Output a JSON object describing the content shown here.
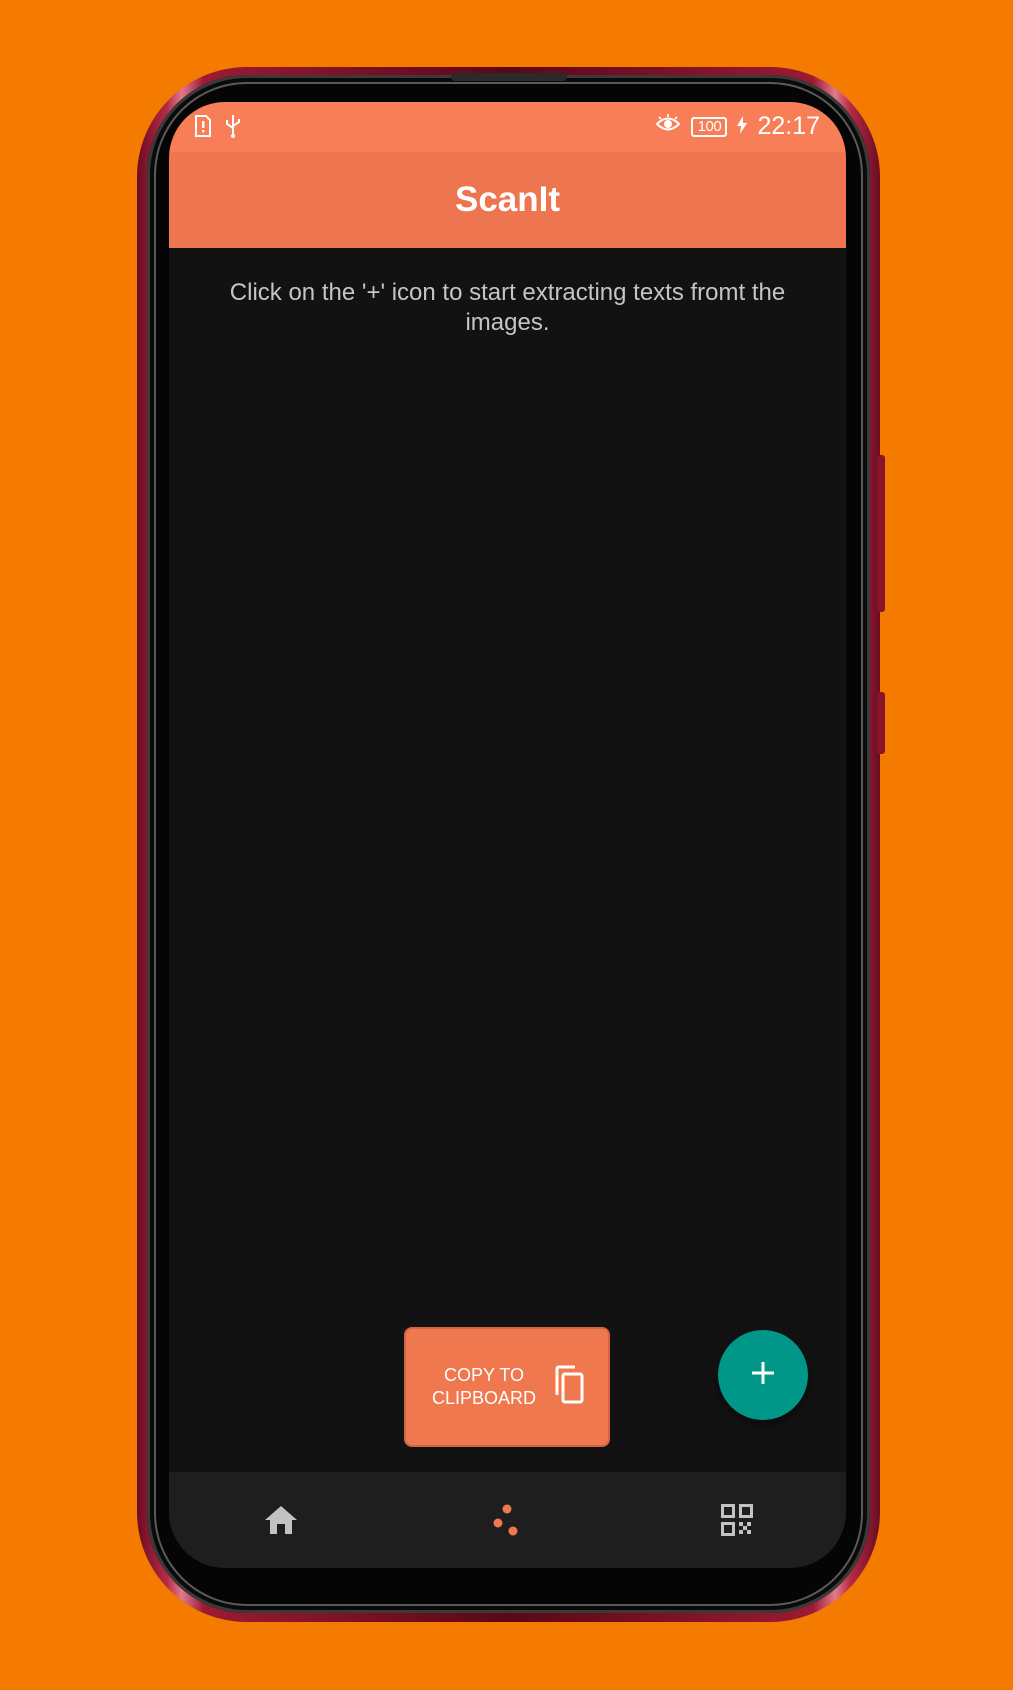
{
  "status_bar": {
    "time": "22:17",
    "battery": "100",
    "icons_left": [
      "sim-alert-icon",
      "usb-icon"
    ],
    "icons_right": [
      "eye-comfort-icon",
      "battery-icon",
      "charging-icon"
    ]
  },
  "app_bar": {
    "title": "ScanIt"
  },
  "main": {
    "hint": "Click on the '+' icon to start extracting texts fromt the images."
  },
  "copy_button": {
    "label": "COPY TO CLIPBOARD",
    "icon": "copy-icon"
  },
  "fab": {
    "icon": "plus-icon"
  },
  "bottom_nav": {
    "items": [
      {
        "icon": "home-icon",
        "active": false
      },
      {
        "icon": "scatter-dots-icon",
        "active": true
      },
      {
        "icon": "qr-code-icon",
        "active": false
      }
    ]
  },
  "colors": {
    "background": "#f47a00",
    "app_bar": "#ed754f",
    "status_bar": "#f77e57",
    "screen": "#121212",
    "fab": "#009688",
    "nav": "#1e1e1e",
    "accent": "#f0784f"
  }
}
